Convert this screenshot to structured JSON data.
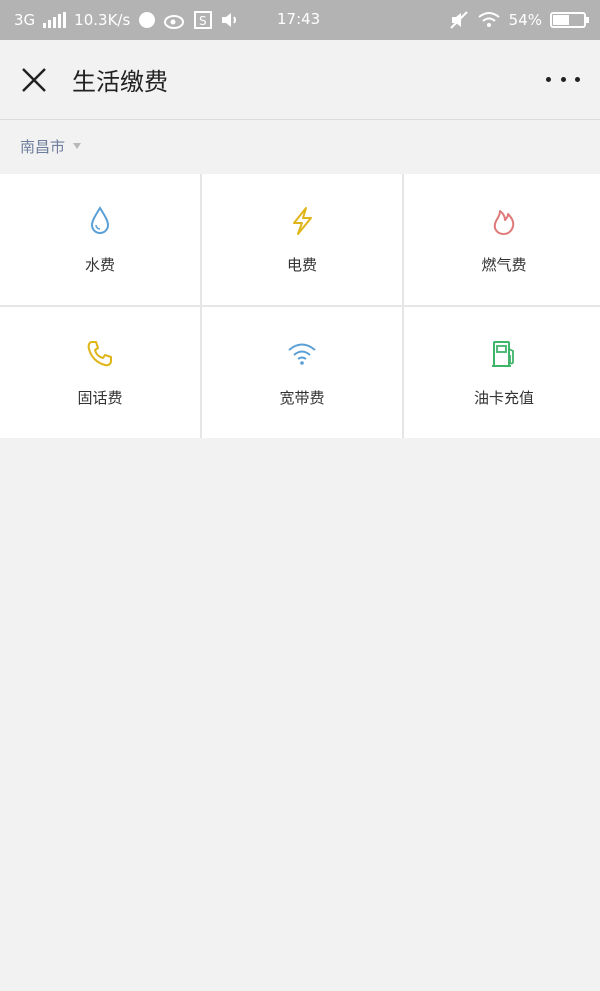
{
  "status_bar": {
    "network": "3G",
    "speed": "10.3K/s",
    "time": "17:43",
    "battery": "54%",
    "battery_level": 0.54
  },
  "nav": {
    "title": "生活缴费"
  },
  "city": {
    "name": "南昌市"
  },
  "services": [
    {
      "label": "水费",
      "icon": "water-drop-icon",
      "color": "#5a9fd6"
    },
    {
      "label": "电费",
      "icon": "lightning-icon",
      "color": "#e0b51a"
    },
    {
      "label": "燃气费",
      "icon": "flame-icon",
      "color": "#e07a7a"
    },
    {
      "label": "固话费",
      "icon": "phone-icon",
      "color": "#e0b51a"
    },
    {
      "label": "宽带费",
      "icon": "wifi-icon",
      "color": "#5a9fd6"
    },
    {
      "label": "油卡充值",
      "icon": "fuel-pump-icon",
      "color": "#3fb56a"
    }
  ]
}
